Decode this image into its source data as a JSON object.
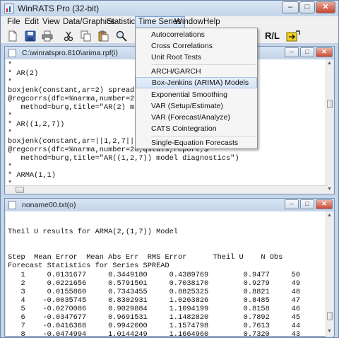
{
  "app": {
    "title": "WinRATS Pro (32-bit)",
    "min": "–",
    "max": "□",
    "close": "✕"
  },
  "menubar": [
    "File",
    "Edit",
    "View",
    "Data/Graphics",
    "Statistics",
    "Time Series",
    "Window",
    "Help"
  ],
  "toolbar_text": "R/L",
  "dropdown": {
    "group1": [
      "Autocorrelations",
      "Cross Correlations",
      "Unit Root Tests"
    ],
    "group2": [
      "ARCH/GARCH",
      "Box-Jenkins (ARIMA) Models",
      "Exponential Smoothing",
      "VAR (Setup/Estimate)",
      "VAR (Forecast/Analyze)",
      "CATS Cointegration"
    ],
    "group3": [
      "Single-Equation Forecasts"
    ]
  },
  "window1": {
    "title": "C:\\winratspro.810\\arima.rpf(i)",
    "lines": [
      "*",
      "* AR(2)",
      "*",
      "boxjenk(constant,ar=2) spread",
      "@regcorrs(dfc=%narma,number=20",
      "   method=burg,title=\"AR(2) mod",
      "*",
      "* AR((1,2,7))",
      "*",
      "boxjenk(constant,ar=||1,2,7||) s",
      "@regcorrs(dfc=%narma,number=20,qstats,report,$",
      "   method=burg,title=\"AR((1,2,7)) model diagnostics\")",
      "*",
      "* ARMA(1,1)",
      "*"
    ]
  },
  "window2": {
    "title": "noname00.txt(o)",
    "lines": [
      "",
      "Theil U results for ARMA(2,(1,7)) Model",
      "",
      "Step  Mean Error  Mean Abs Err  RMS Error      Theil U    N Obs",
      "Forecast Statistics for Series SPREAD",
      "   1     0.0131677     0.3449180     0.4389769        0.9477     50",
      "   2     0.0221656     0.5791501     0.7038170        0.9279     49",
      "   3     0.0155860     0.7343455     0.8825325        0.8821     48",
      "   4    -0.0035745     0.8302931     1.0263826        0.8485     47",
      "   5    -0.0270086     0.9029884     1.1094199        0.8158     46",
      "   6    -0.0347677     0.9691531     1.1482820        0.7892     45",
      "   7    -0.0416368     0.9942000     1.1574798        0.7613     44",
      "   8    -0.0474994     1.0144249     1.1664960        0.7320     43"
    ]
  },
  "colors": {
    "accent": "#3b6fb6",
    "highlight": "#d6e4f7"
  }
}
